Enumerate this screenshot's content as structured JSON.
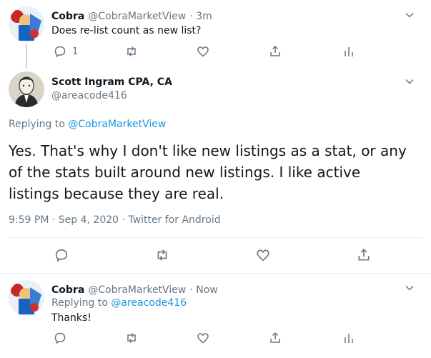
{
  "tweets": [
    {
      "name": "Cobra",
      "handle": "@CobraMarketView",
      "time": "· 3m",
      "text": "Does re-list count as new list?",
      "reply_count": "1"
    },
    {
      "name": "Scott Ingram CPA, CA",
      "handle": "@areacode416",
      "replying_label": "Replying to",
      "replying_handle": "@CobraMarketView",
      "text": "Yes. That's why I don't like new listings as a stat, or any of the stats built around new listings. I like active listings because they are real.",
      "meta": "9:59 PM · Sep 4, 2020 · Twitter for Android"
    },
    {
      "name": "Cobra",
      "handle": "@CobraMarketView",
      "time": "· Now",
      "replying_label": "Replying to",
      "replying_handle": "@areacode416",
      "text": "Thanks!"
    }
  ],
  "colors": {
    "text": "#14171a",
    "muted": "#657786",
    "link": "#1b95e0",
    "divider": "#e6ecf0"
  }
}
